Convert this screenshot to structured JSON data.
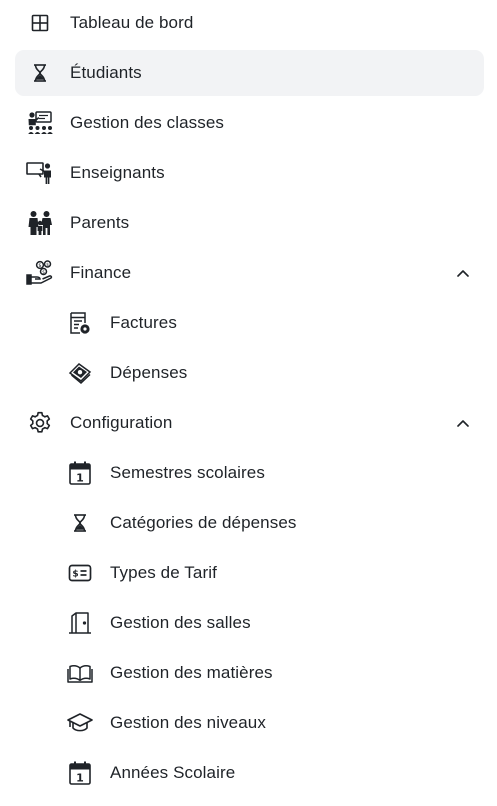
{
  "menu": {
    "dashboard": {
      "label": "Tableau de bord",
      "icon": "grid-icon"
    },
    "students": {
      "label": "Étudiants",
      "icon": "hourglass-icon",
      "active": true
    },
    "classes": {
      "label": "Gestion des classes",
      "icon": "classroom-icon"
    },
    "teachers": {
      "label": "Enseignants",
      "icon": "teacher-board-icon"
    },
    "parents": {
      "label": "Parents",
      "icon": "family-icon"
    },
    "finance": {
      "label": "Finance",
      "icon": "money-hand-icon",
      "expanded": true,
      "children": {
        "invoices": {
          "label": "Factures",
          "icon": "invoice-icon"
        },
        "expenses": {
          "label": "Dépenses",
          "icon": "cash-stack-icon"
        }
      }
    },
    "configuration": {
      "label": "Configuration",
      "icon": "gear-icon",
      "expanded": true,
      "children": {
        "semesters": {
          "label": "Semestres scolaires",
          "icon": "calendar-icon"
        },
        "expense_categories": {
          "label": "Catégories de dépenses",
          "icon": "hourglass-icon"
        },
        "fee_types": {
          "label": "Types de Tarif",
          "icon": "dollar-card-icon"
        },
        "rooms": {
          "label": "Gestion des salles",
          "icon": "door-icon"
        },
        "subjects": {
          "label": "Gestion des matières",
          "icon": "open-book-icon"
        },
        "levels": {
          "label": "Gestion des niveaux",
          "icon": "graduation-cap-icon"
        },
        "school_years": {
          "label": "Années Scolaire",
          "icon": "calendar-icon"
        }
      }
    }
  },
  "colors": {
    "active_bg": "#f2f3f5",
    "text": "#1f2328",
    "icon": "#1f2328"
  }
}
